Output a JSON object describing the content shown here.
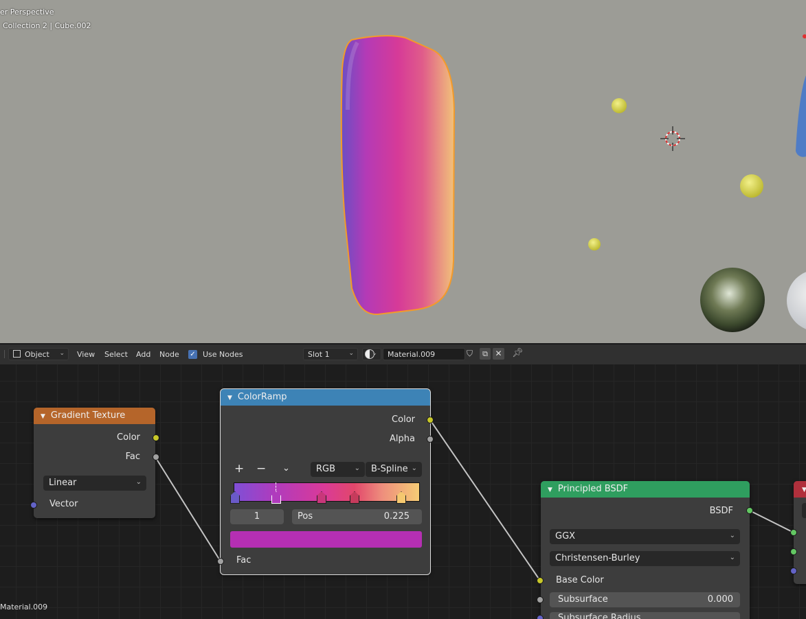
{
  "viewport": {
    "title": "er Perspective",
    "breadcrumb": "Collection 2 | Cube.002",
    "object_label": "Material.009"
  },
  "header": {
    "mode": "Object",
    "menus": [
      "View",
      "Select",
      "Add",
      "Node"
    ],
    "use_nodes_label": "Use Nodes",
    "use_nodes_checked": true,
    "slot": "Slot 1",
    "material_name": "Material.009"
  },
  "nodes": {
    "gradient_texture": {
      "title": "Gradient Texture",
      "color": "#b5652a",
      "out_color": "Color",
      "out_fac": "Fac",
      "type": "Linear",
      "in_vector": "Vector"
    },
    "colorramp": {
      "title": "ColorRamp",
      "color": "#3d83b6",
      "out_color": "Color",
      "out_alpha": "Alpha",
      "add": "+",
      "remove": "−",
      "color_mode": "RGB",
      "interpolation": "B-Spline",
      "stop_index": "1",
      "pos_label": "Pos",
      "pos_value": "0.225",
      "active_color": "#b52fb3",
      "in_fac": "Fac"
    },
    "principled": {
      "title": "Principled BSDF",
      "color": "#2f9e5f",
      "out_bsdf": "BSDF",
      "distribution": "GGX",
      "subsurface_method": "Christensen-Burley",
      "base_color": "Base Color",
      "subsurface_label": "Subsurface",
      "subsurface_value": "0.000",
      "subsurface_radius": "Subsurface Radius"
    }
  }
}
